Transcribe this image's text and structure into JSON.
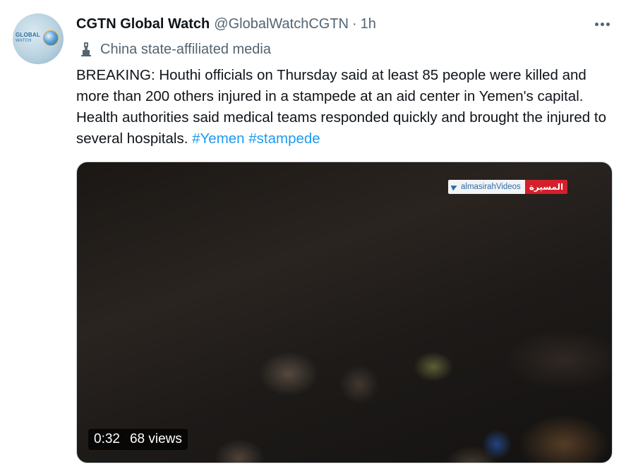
{
  "author": {
    "display_name": "CGTN Global Watch",
    "handle": "@GlobalWatchCGTN",
    "separator": "·",
    "time": "1h",
    "avatar_text_line1": "GLOBAL",
    "avatar_text_line2": "WATCH",
    "affiliation_icon": "government-building-icon",
    "affiliation": "China state-affiliated media"
  },
  "tweet": {
    "text": "BREAKING: Houthi officials on Thursday said at least 85 people were killed and more than 200 others injured in a stampede at an aid center in Yemen's capital. Health authorities said medical teams responded quickly and brought the injured to several hospitals.",
    "hashtags": [
      "#Yemen",
      "#stampede"
    ]
  },
  "media": {
    "watermark_left": "almasirahVideos",
    "watermark_right": "المسيرة",
    "duration": "0:32",
    "views": "68 views"
  },
  "icons": {
    "more": "more-icon",
    "affiliation": "government-building-icon",
    "watermark": "telegram-icon"
  },
  "colors": {
    "link": "#1d9bf0",
    "secondary_text": "#536471",
    "primary_text": "#0f1419",
    "watermark_red": "#d4202c"
  }
}
